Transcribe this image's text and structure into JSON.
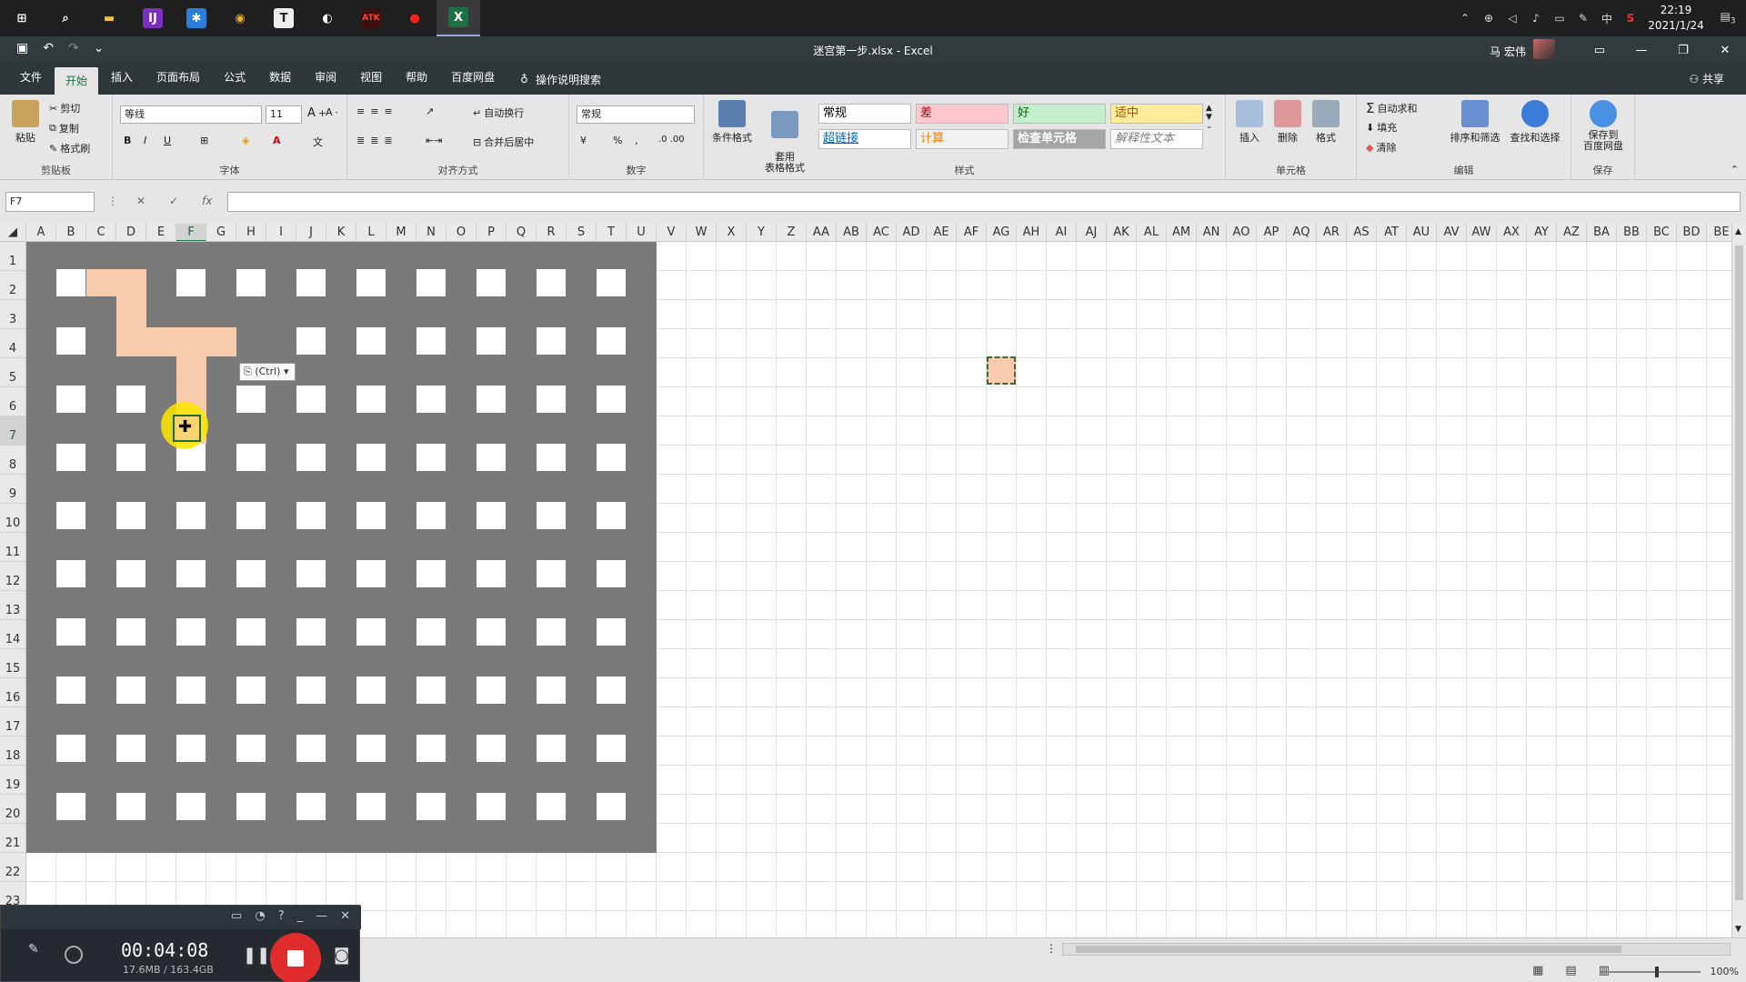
{
  "taskbar": {
    "apps": [
      {
        "name": "start-icon",
        "glyph": "⊞",
        "color": "#ffffff",
        "bg": "transparent"
      },
      {
        "name": "search-icon",
        "glyph": "⌕",
        "color": "#ffffff",
        "bg": "transparent"
      },
      {
        "name": "file-explorer-icon",
        "glyph": "▬",
        "color": "#f0c040",
        "bg": "transparent"
      },
      {
        "name": "intellij-icon",
        "glyph": "IJ",
        "color": "#ffffff",
        "bg": "#7b2fbf"
      },
      {
        "name": "app-star-icon",
        "glyph": "✱",
        "color": "#ffffff",
        "bg": "#2b7fd8"
      },
      {
        "name": "chrome-icon",
        "glyph": "◉",
        "color": "#e8b030",
        "bg": "transparent"
      },
      {
        "name": "typora-icon",
        "glyph": "T",
        "color": "#222222",
        "bg": "#eeeeee"
      },
      {
        "name": "media-player-icon",
        "glyph": "◐",
        "color": "#ffffff",
        "bg": "transparent"
      },
      {
        "name": "atk-icon",
        "glyph": "ATK",
        "color": "#ff4040",
        "bg": "#3a1010"
      },
      {
        "name": "record-icon",
        "glyph": "●",
        "color": "#ff2020",
        "bg": "transparent"
      },
      {
        "name": "excel-icon",
        "glyph": "X",
        "color": "#ffffff",
        "bg": "#1e7145"
      }
    ],
    "tray_icons": [
      "chevron-up-icon",
      "globe-icon",
      "volume-icon",
      "mic-icon",
      "battery-icon",
      "pen-icon"
    ],
    "tray_glyphs": [
      "⌃",
      "⊕",
      "◁",
      "♪",
      "▭",
      "✎"
    ],
    "ime": "中",
    "sogou": "S",
    "time": "22:19",
    "date": "2021/1/24",
    "notifications": "3"
  },
  "window": {
    "title": "迷宫第一步.xlsx  -  Excel",
    "user": "马 宏伟",
    "share": "共享"
  },
  "tabs": [
    "文件",
    "开始",
    "插入",
    "页面布局",
    "公式",
    "数据",
    "审阅",
    "视图",
    "帮助",
    "百度网盘"
  ],
  "active_tab": "开始",
  "tell_me": "操作说明搜索",
  "ribbon": {
    "clipboard": {
      "label": "剪贴板",
      "paste": "粘贴",
      "cut": "剪切",
      "copy": "复制",
      "format_painter": "格式刷"
    },
    "font": {
      "label": "字体",
      "name": "等线",
      "size": "11",
      "bold": "B",
      "italic": "I",
      "underline": "U"
    },
    "alignment": {
      "label": "对齐方式",
      "wrap": "自动换行",
      "merge": "合并后居中"
    },
    "number": {
      "label": "数字",
      "format": "常规",
      "percent": "%",
      "comma": ","
    },
    "styles": {
      "label": "样式",
      "conditional": "条件格式",
      "table": "套用\n表格格式",
      "cells": [
        {
          "text": "常规",
          "bg": "#ffffff",
          "color": "#000000"
        },
        {
          "text": "差",
          "bg": "#ffc7ce",
          "color": "#9c0006"
        },
        {
          "text": "好",
          "bg": "#c6efce",
          "color": "#006100"
        },
        {
          "text": "适中",
          "bg": "#ffeb9c",
          "color": "#9c5700"
        },
        {
          "text": "超链接",
          "bg": "#ffffff",
          "color": "#0563c1"
        },
        {
          "text": "计算",
          "bg": "#f2f2f2",
          "color": "#fa7d00"
        },
        {
          "text": "检查单元格",
          "bg": "#a5a5a5",
          "color": "#ffffff"
        },
        {
          "text": "解释性文本",
          "bg": "#ffffff",
          "color": "#7f7f7f"
        }
      ]
    },
    "cells": {
      "label": "单元格",
      "insert": "插入",
      "delete": "删除",
      "format": "格式"
    },
    "editing": {
      "label": "编辑",
      "autosum": "自动求和",
      "fill": "填充",
      "clear": "清除",
      "sort": "排序和筛选",
      "find": "查找和选择"
    },
    "save": {
      "label": "保存",
      "button": "保存到\n百度网盘"
    }
  },
  "formula_bar": {
    "name_box": "F7",
    "fx": "fx",
    "cancel": "✕",
    "enter": "✓",
    "value": ""
  },
  "columns": [
    "A",
    "B",
    "C",
    "D",
    "E",
    "F",
    "G",
    "H",
    "I",
    "J",
    "K",
    "L",
    "M",
    "N",
    "O",
    "P",
    "Q",
    "R",
    "S",
    "T",
    "U",
    "V",
    "W",
    "X",
    "Y",
    "Z",
    "AA",
    "AB",
    "AC",
    "AD",
    "AE",
    "AF",
    "AG",
    "AH",
    "AI",
    "AJ",
    "AK",
    "AL",
    "AM",
    "AN",
    "AO",
    "AP",
    "AQ",
    "AR",
    "AS",
    "AT",
    "AU",
    "AV",
    "AW",
    "AX",
    "AY",
    "AZ",
    "BA",
    "BB",
    "BC",
    "BD",
    "BE"
  ],
  "selected_column": "F",
  "rows": [
    "1",
    "2",
    "3",
    "4",
    "5",
    "6",
    "7",
    "8",
    "9",
    "10",
    "11",
    "12",
    "13",
    "14",
    "15",
    "16",
    "17",
    "18",
    "19",
    "20",
    "21",
    "22",
    "23"
  ],
  "selected_row": "7",
  "paste_options": "(Ctrl)",
  "maze": {
    "wall_color": "#7a7a7a",
    "path_color": "#f8cbad",
    "cols": 10,
    "rows": 10
  },
  "status": {
    "zoom": "100%"
  },
  "recorder": {
    "time": "00:04:08",
    "size": "17.6MB / 163.4GB"
  }
}
